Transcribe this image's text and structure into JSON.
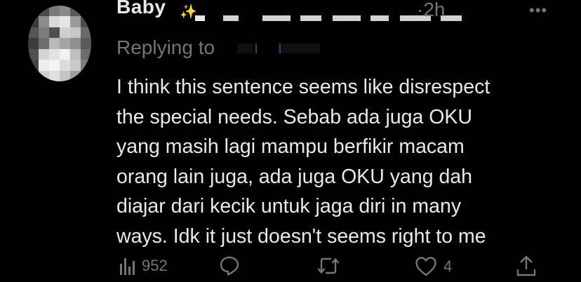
{
  "tweet": {
    "author_name": "Baby",
    "author_handle_hidden": "@...",
    "time": "·2h",
    "more_label": "•••",
    "replying_to_label": "Replying to",
    "text": "I think this sentence seems like disrespect\nthe special needs. Sebab ada juga OKU\nyang masih lagi mampu berfikir macam\norang lain juga, ada juga OKU yang dah\ndiajar dari kecik untuk jaga diri in many\nways. Idk it just doesn't seems right to me"
  },
  "actions": {
    "views_icon": "bar-chart-icon",
    "views_count": "952",
    "reply_icon": "reply-icon",
    "retweet_icon": "retweet-icon",
    "like_icon": "heart-icon",
    "like_count": "4",
    "share_icon": "share-icon"
  },
  "colors": {
    "background": "#000000",
    "text_primary": "#e7e9ea",
    "text_secondary": "#71767b",
    "sparkle": "#f5c518"
  }
}
